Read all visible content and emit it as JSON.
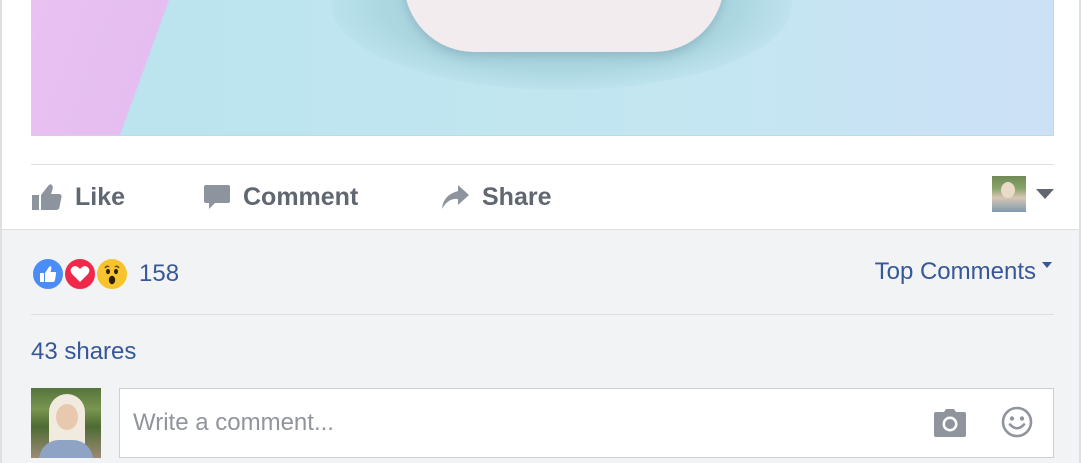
{
  "post": {
    "actions": {
      "like_label": "Like",
      "comment_label": "Comment",
      "share_label": "Share"
    }
  },
  "reactions": {
    "types": [
      "like-reaction",
      "love-reaction",
      "wow-reaction"
    ],
    "count": "158"
  },
  "sort": {
    "label": "Top Comments"
  },
  "shares": {
    "label": "43 shares"
  },
  "composer": {
    "placeholder": "Write a comment..."
  },
  "colors": {
    "link_blue": "#365899",
    "action_grey": "#606770",
    "like_blue": "#4a8df7",
    "love_red": "#f0284a",
    "wow_yellow": "#f7c42d",
    "comment_bg": "#f2f3f5"
  }
}
